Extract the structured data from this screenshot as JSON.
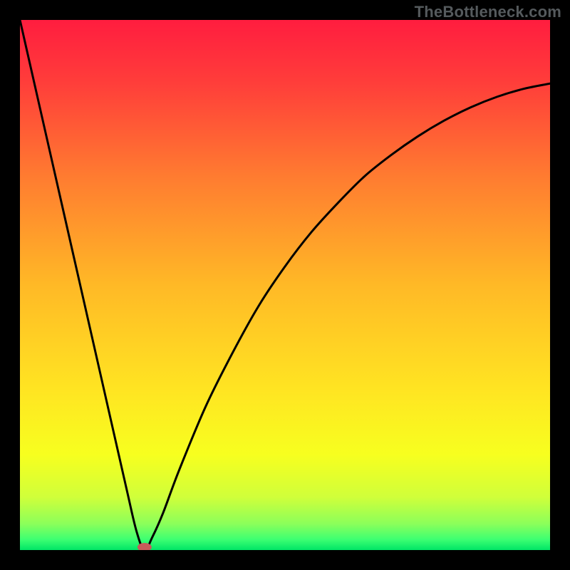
{
  "watermark": "TheBottleneck.com",
  "chart_data": {
    "type": "line",
    "title": "",
    "xlabel": "",
    "ylabel": "",
    "xlim": [
      0,
      100
    ],
    "ylim": [
      0,
      100
    ],
    "grid": false,
    "series": [
      {
        "name": "bottleneck-curve",
        "x": [
          0,
          5,
          10,
          15,
          20,
          22,
          23.5,
          25,
          27,
          30,
          35,
          40,
          45,
          50,
          55,
          60,
          65,
          70,
          75,
          80,
          85,
          90,
          95,
          100
        ],
        "values": [
          100,
          78,
          56,
          34,
          12,
          3.5,
          0,
          2.5,
          7,
          15,
          27,
          37,
          46,
          53.5,
          60,
          65.5,
          70.5,
          74.5,
          78,
          81,
          83.5,
          85.5,
          87,
          88
        ]
      }
    ],
    "marker": {
      "x": 23.5,
      "y": 0,
      "color": "#c85a5a"
    },
    "gradient_stops": [
      {
        "offset": 0.0,
        "color": "#ff1d3f"
      },
      {
        "offset": 0.12,
        "color": "#ff3e3a"
      },
      {
        "offset": 0.3,
        "color": "#ff7d30"
      },
      {
        "offset": 0.5,
        "color": "#ffb926"
      },
      {
        "offset": 0.7,
        "color": "#ffe522"
      },
      {
        "offset": 0.82,
        "color": "#f7ff1f"
      },
      {
        "offset": 0.9,
        "color": "#d0ff3a"
      },
      {
        "offset": 0.95,
        "color": "#8cff5a"
      },
      {
        "offset": 0.98,
        "color": "#3dff72"
      },
      {
        "offset": 1.0,
        "color": "#00e566"
      }
    ]
  }
}
